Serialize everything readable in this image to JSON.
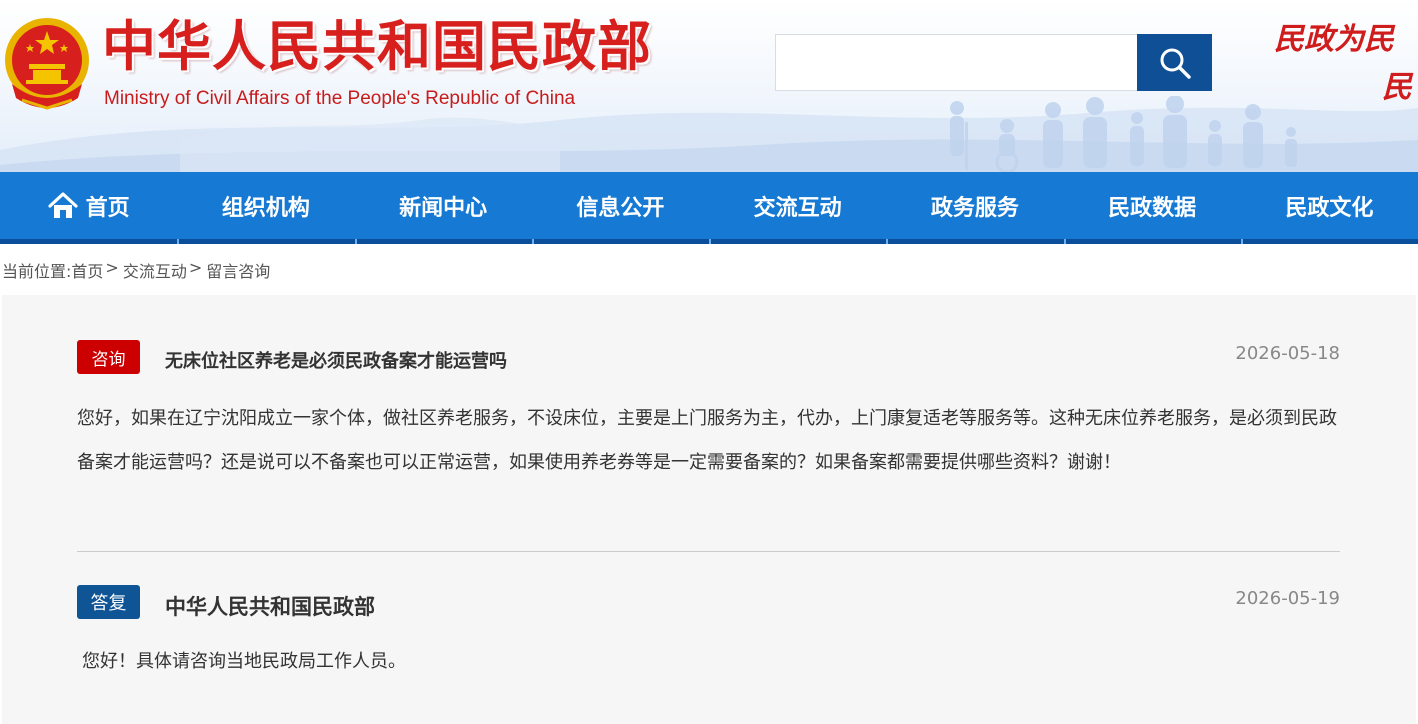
{
  "header": {
    "site_title": "中华人民共和国民政部",
    "site_subtitle": "Ministry of Civil Affairs of the People's Republic of China",
    "slogan_line1": "民政为民",
    "slogan_line2": "民",
    "search_placeholder": "",
    "colors": {
      "title_red": "#d7201e",
      "search_button": "#0f4f95"
    }
  },
  "nav": {
    "items": [
      {
        "label": "首页",
        "icon": "home-icon"
      },
      {
        "label": "组织机构"
      },
      {
        "label": "新闻中心"
      },
      {
        "label": "信息公开"
      },
      {
        "label": "交流互动"
      },
      {
        "label": "政务服务"
      },
      {
        "label": "民政数据"
      },
      {
        "label": "民政文化"
      }
    ],
    "colors": {
      "bar": "#1679d3",
      "underline": "#0b4f9b"
    }
  },
  "breadcrumb": {
    "prefix": "当前位置:",
    "items": [
      "首页",
      "交流互动",
      "留言咨询"
    ],
    "separator": ">"
  },
  "consultation": {
    "badge": "咨询",
    "title": "无床位社区养老是必须民政备案才能运营吗",
    "date": "2026-05-18",
    "body": "您好，如果在辽宁沈阳成立一家个体，做社区养老服务，不设床位，主要是上门服务为主，代办，上门康复适老等服务等。这种无床位养老服务，是必须到民政备案才能运营吗？还是说可以不备案也可以正常运营，如果使用养老券等是一定需要备案的？如果备案都需要提供哪些资料？谢谢！",
    "badge_color": "#cc0000"
  },
  "reply": {
    "badge": "答复",
    "title": "中华人民共和国民政部",
    "date": "2026-05-19",
    "body": "您好！具体请咨询当地民政局工作人员。",
    "badge_color": "#0f5494"
  }
}
